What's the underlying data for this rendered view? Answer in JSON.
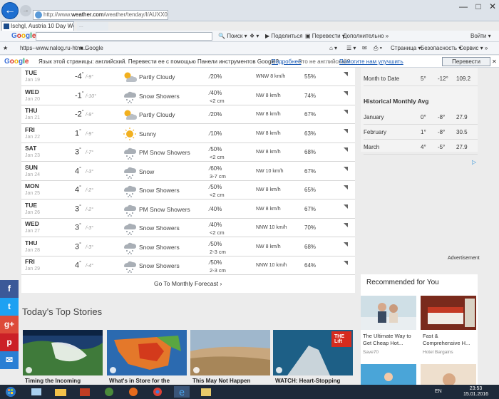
{
  "browser": {
    "address_prefix": "http://www.",
    "address_domain": "weather.com",
    "address_rest": "/weather/tenday/l/AUXX0123:1:AU",
    "tab_active": "Ischgl, Austria 10 Day Weat...",
    "tab_inactive": "...",
    "google": {
      "logo": "Google",
      "search_btn": "Поиск",
      "share": "Поделиться",
      "translate": "Перевести",
      "more": "Дополнительно",
      "signin": "Войти"
    },
    "favorites": [
      "https--www.nalog.ru-htm...",
      "Google"
    ],
    "commands": [
      "Страница",
      "Безопасность",
      "Сервис"
    ],
    "translate_bar": {
      "logo": "Google",
      "prompt": "Язык этой страницы: английский. Перевести ее с помощью Панели инструментов Google?",
      "details": "Подробнее",
      "not_english": "Это не английский?",
      "improve": "Помогите нам улучшить",
      "button": "Перевести"
    }
  },
  "forecast": {
    "rows": [
      {
        "day": "TUE",
        "date": "Jan 19",
        "hi": "-4",
        "lo": "-9",
        "icon": "sun-cloud",
        "cond": "Partly Cloudy",
        "precip": "20%",
        "snow": "",
        "wind": "WNW 8 km/h",
        "humidity": "55%"
      },
      {
        "day": "WED",
        "date": "Jan 20",
        "hi": "-1",
        "lo": "-10",
        "icon": "snow",
        "cond": "Snow Showers",
        "precip": "40%",
        "snow": "<2 cm",
        "wind": "NW 8 km/h",
        "humidity": "74%"
      },
      {
        "day": "THU",
        "date": "Jan 21",
        "hi": "-2",
        "lo": "-9",
        "icon": "sun-cloud",
        "cond": "Partly Cloudy",
        "precip": "20%",
        "snow": "",
        "wind": "NW 8 km/h",
        "humidity": "67%"
      },
      {
        "day": "FRI",
        "date": "Jan 22",
        "hi": "1",
        "lo": "-9",
        "icon": "sun",
        "cond": "Sunny",
        "precip": "10%",
        "snow": "",
        "wind": "NW 8 km/h",
        "humidity": "63%"
      },
      {
        "day": "SAT",
        "date": "Jan 23",
        "hi": "3",
        "lo": "-7",
        "icon": "snow",
        "cond": "PM Snow Showers",
        "precip": "50%",
        "snow": "<2 cm",
        "wind": "NW 8 km/h",
        "humidity": "68%"
      },
      {
        "day": "SUN",
        "date": "Jan 24",
        "hi": "4",
        "lo": "-3",
        "icon": "snow",
        "cond": "Snow",
        "precip": "60%",
        "snow": "3-7 cm",
        "wind": "NW 10 km/h",
        "humidity": "67%"
      },
      {
        "day": "MON",
        "date": "Jan 25",
        "hi": "4",
        "lo": "-2",
        "icon": "snow",
        "cond": "Snow Showers",
        "precip": "50%",
        "snow": "<2 cm",
        "wind": "NW 8 km/h",
        "humidity": "65%"
      },
      {
        "day": "TUE",
        "date": "Jan 26",
        "hi": "3",
        "lo": "-2",
        "icon": "snow",
        "cond": "PM Snow Showers",
        "precip": "40%",
        "snow": "",
        "wind": "NW 8 km/h",
        "humidity": "67%"
      },
      {
        "day": "WED",
        "date": "Jan 27",
        "hi": "3",
        "lo": "-3",
        "icon": "snow",
        "cond": "Snow Showers",
        "precip": "40%",
        "snow": "<2 cm",
        "wind": "NNW 10 km/h",
        "humidity": "70%"
      },
      {
        "day": "THU",
        "date": "Jan 28",
        "hi": "3",
        "lo": "-3",
        "icon": "snow",
        "cond": "Snow Showers",
        "precip": "50%",
        "snow": "2-3 cm",
        "wind": "NW 8 km/h",
        "humidity": "68%"
      },
      {
        "day": "FRI",
        "date": "Jan 29",
        "hi": "4",
        "lo": "-4",
        "icon": "snow",
        "cond": "Snow Showers",
        "precip": "50%",
        "snow": "2-3 cm",
        "wind": "NNW 10 km/h",
        "humidity": "64%"
      }
    ],
    "monthly_link": "Go To Monthly Forecast"
  },
  "history": {
    "month_to_date": {
      "label": "Month to Date",
      "hi": "5",
      "lo": "-12",
      "precip": "109.2"
    },
    "heading": "Historical Monthly Avg",
    "rows": [
      {
        "month": "January",
        "hi": "0",
        "lo": "-8",
        "precip": "27.9"
      },
      {
        "month": "February",
        "hi": "1",
        "lo": "-8",
        "precip": "30.5"
      },
      {
        "month": "March",
        "hi": "4",
        "lo": "-5",
        "precip": "27.9"
      }
    ]
  },
  "ads": {
    "label": "Advertisement",
    "marker": "▷",
    "rec_title": "Recommended for You",
    "cards": [
      {
        "text": "The Ultimate Way to Get Cheap Hot...",
        "source": "Save70"
      },
      {
        "text": "Fast & Comprehensive H...",
        "source": "Hotel Bargains"
      }
    ]
  },
  "social": [
    "f",
    "t",
    "g+",
    "p",
    "✉"
  ],
  "stories": {
    "title": "Today's Top Stories",
    "items": [
      {
        "title": "Timing the Incoming"
      },
      {
        "title": "What's in Store for the"
      },
      {
        "title": "This May Not Happen"
      },
      {
        "title": "WATCH: Heart-Stopping"
      }
    ],
    "badge": "THE Lift"
  },
  "taskbar": {
    "lang": "EN",
    "time": "23:53",
    "date": "15.01.2016"
  },
  "colors": {
    "accent": "#1e6fd0",
    "facebook": "#3b5998",
    "twitter": "#1da1f2",
    "gplus": "#dd4b39",
    "pinterest": "#cb2027",
    "email": "#2a7fd4"
  }
}
